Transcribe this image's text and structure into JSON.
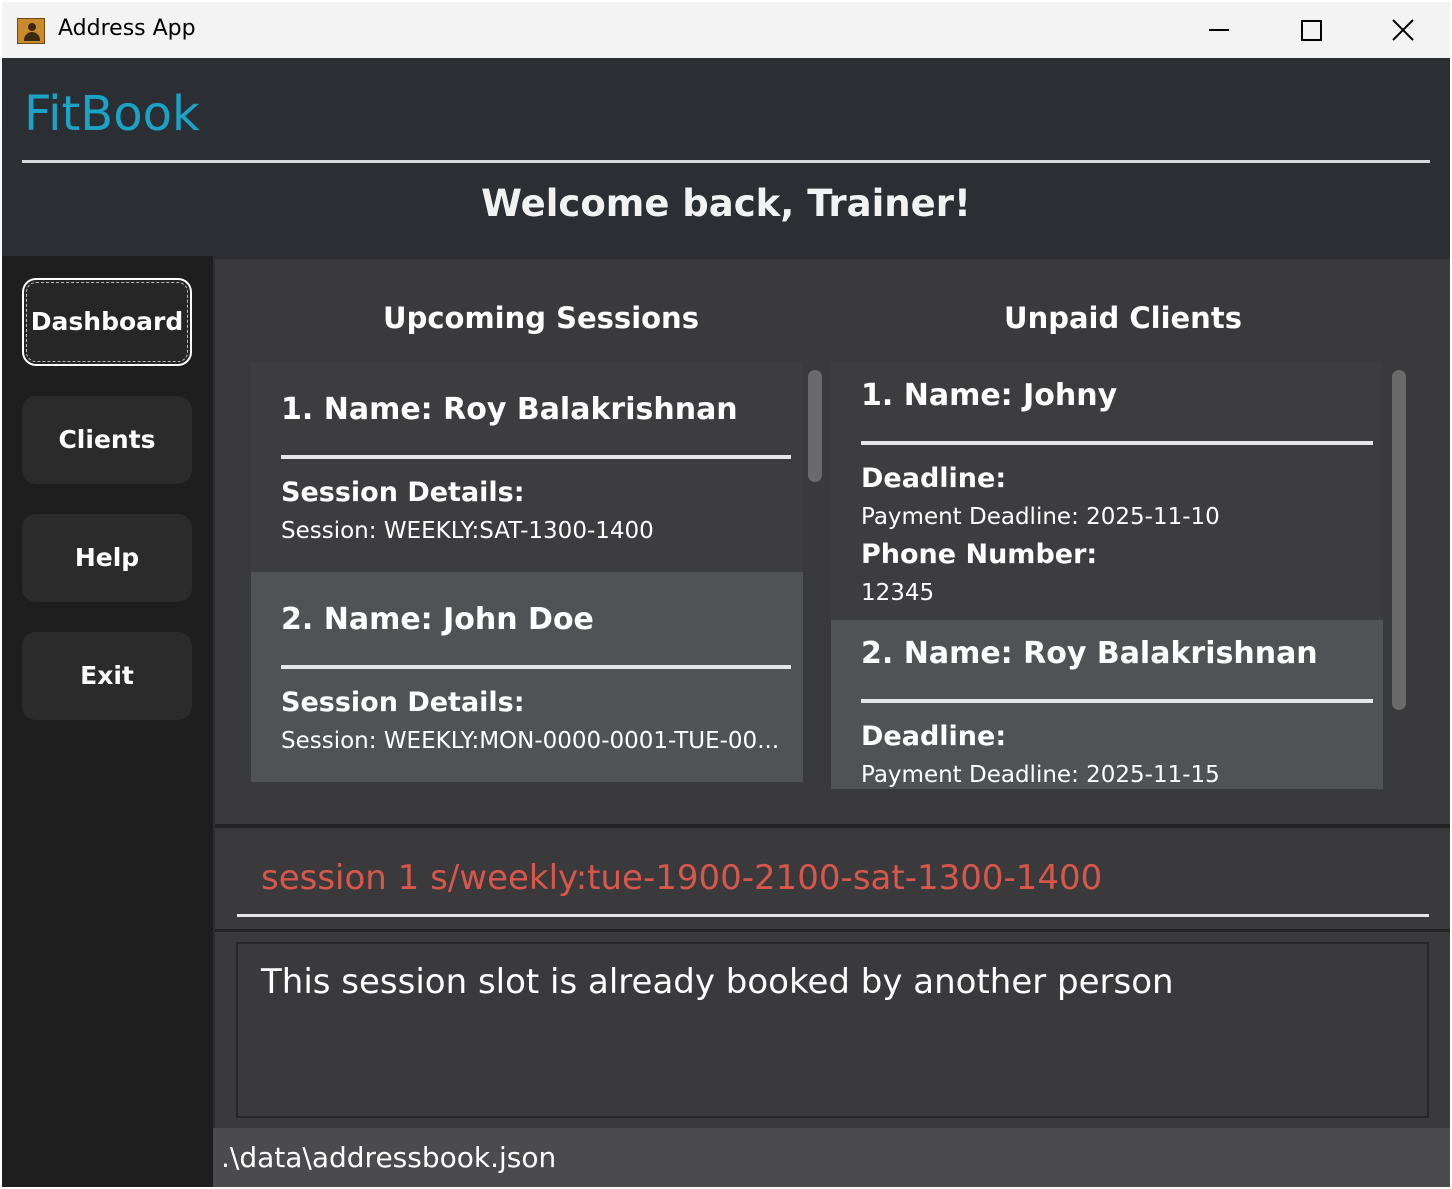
{
  "window": {
    "title": "Address App",
    "icon": "address-book-icon",
    "controls": [
      "minimize-icon",
      "maximize-icon",
      "close-icon"
    ]
  },
  "header": {
    "brand": "FitBook",
    "welcome": "Welcome back, Trainer!"
  },
  "sidebar": {
    "items": [
      {
        "label": "Dashboard",
        "active": true
      },
      {
        "label": "Clients",
        "active": false
      },
      {
        "label": "Help",
        "active": false
      },
      {
        "label": "Exit",
        "active": false
      }
    ]
  },
  "sessions": {
    "title": "Upcoming Sessions",
    "items": [
      {
        "name": "1. Name: Roy Balakrishnan",
        "details_label": "Session Details:",
        "details": "Session: WEEKLY:SAT-1300-1400"
      },
      {
        "name": "2. Name: John Doe",
        "details_label": "Session Details:",
        "details": "Session: WEEKLY:MON-0000-0001-TUE-00..."
      }
    ]
  },
  "unpaid": {
    "title": "Unpaid Clients",
    "items": [
      {
        "name": "1. Name: Johny",
        "deadline_label": "Deadline:",
        "deadline": "Payment Deadline: 2025-11-10",
        "phone_label": "Phone Number:",
        "phone": "12345"
      },
      {
        "name": "2. Name: Roy Balakrishnan",
        "deadline_label": "Deadline:",
        "deadline": "Payment Deadline: 2025-11-15"
      }
    ]
  },
  "command": {
    "value": "session 1 s/weekly:tue-1900-2100-sat-1300-1400",
    "error_color": "#d9574a"
  },
  "result": {
    "message": "This session slot is already booked by another person"
  },
  "status": {
    "file_path": ".\\data\\addressbook.json"
  },
  "colors": {
    "brand": "#1aa3c7",
    "card": "#3a3a3c",
    "card_selected": "#505356"
  }
}
